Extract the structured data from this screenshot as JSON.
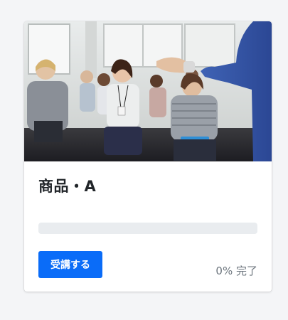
{
  "course": {
    "image_icon": "seminar-audience-photo",
    "title": "商品・A",
    "progress_fraction": 0,
    "enroll_label": "受講する",
    "progress_text": "0% 完了"
  },
  "colors": {
    "primary": "#0a6cf8",
    "progress_track": "#e9ecef",
    "muted_text": "#6c757d",
    "page_bg": "#f4f5f7"
  }
}
